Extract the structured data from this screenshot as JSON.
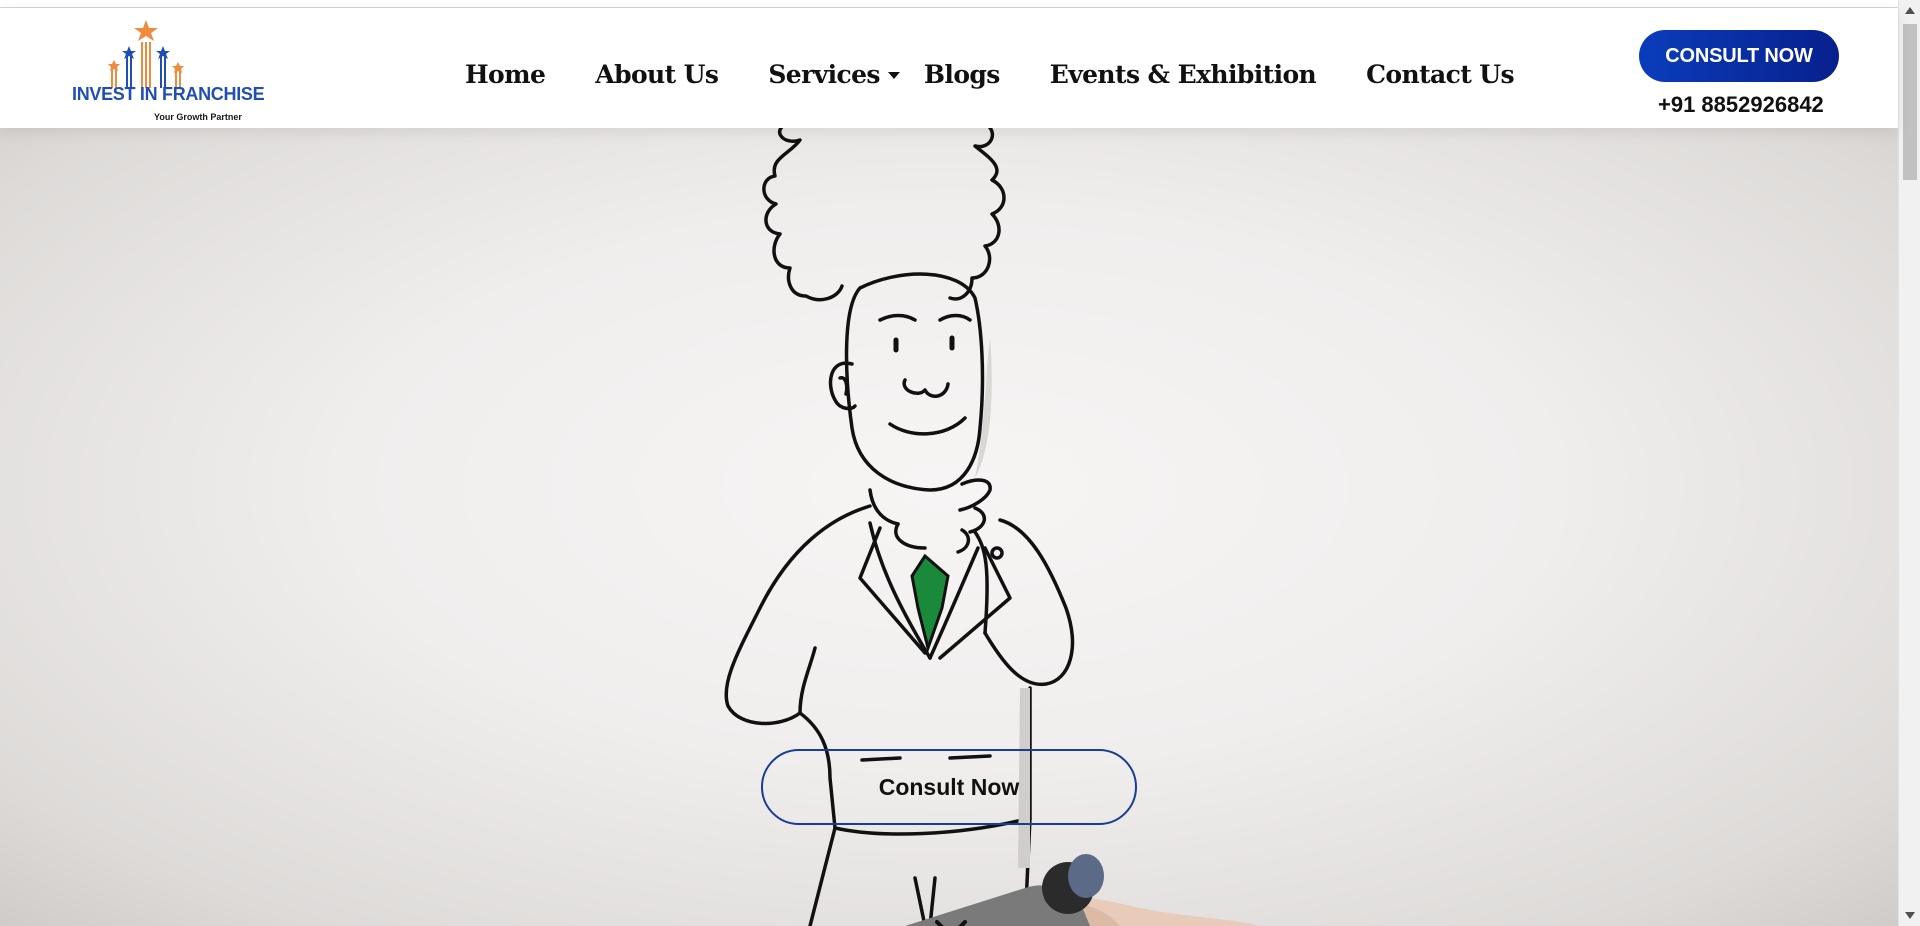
{
  "header": {
    "logo": {
      "title": "INVEST IN FRANCHISE",
      "tagline": "Your Growth Partner"
    },
    "nav": [
      {
        "label": "Home"
      },
      {
        "label": "About Us"
      },
      {
        "label": "Services"
      },
      {
        "label": "Blogs"
      },
      {
        "label": "Events & Exhibition"
      },
      {
        "label": "Contact Us"
      }
    ],
    "cta_label": "CONSULT NOW",
    "phone": "+91 8852926842"
  },
  "hero": {
    "cta_label": "Consult Now",
    "scroll_icon": "double-chevron-down-icon"
  },
  "colors": {
    "brand_blue": "#0a3dbb",
    "brand_orange": "#f08a3c",
    "tie_green": "#1a8a3a"
  }
}
